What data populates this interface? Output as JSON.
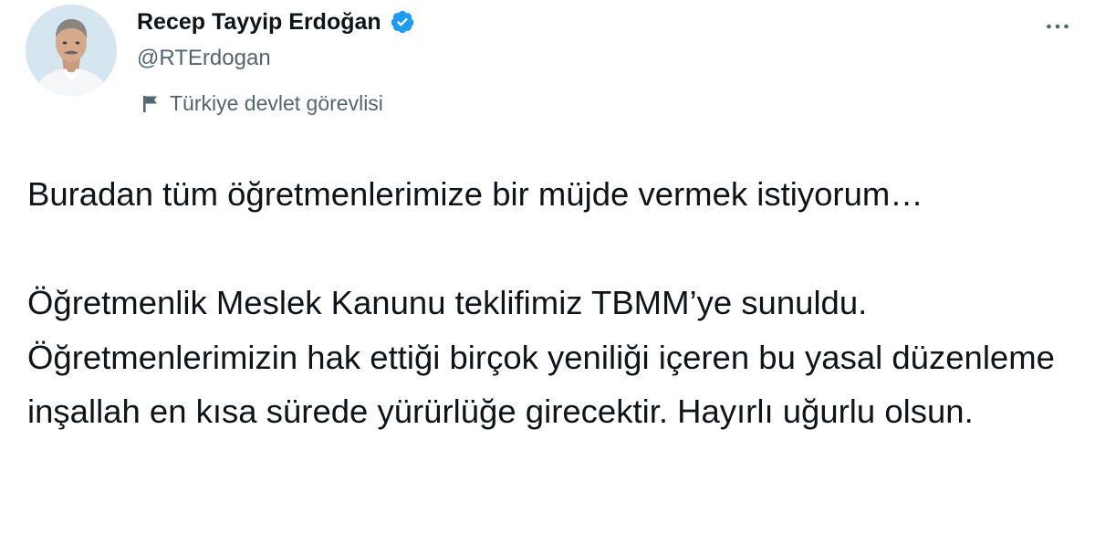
{
  "author": {
    "display_name": "Recep Tayyip Erdoğan",
    "handle": "@RTErdogan",
    "label": "Türkiye devlet görevlisi",
    "avatar_icon": "profile-photo",
    "verified_icon": "verified-badge-icon",
    "flag_icon": "flag-icon"
  },
  "menu": {
    "icon": "more-horizontal-icon"
  },
  "tweet": {
    "paragraphs": [
      "Buradan tüm öğretmenlerimize bir müjde vermek istiyorum…",
      "Öğretmenlik Meslek Kanunu teklifimiz TBMM’ye sunuldu. Öğretmenlerimizin hak ettiği birçok yeniliği içeren bu yasal düzenleme inşallah en kısa sürede yürürlüğe girecektir. Hayırlı uğurlu olsun."
    ]
  },
  "colors": {
    "text_primary": "#0f1419",
    "text_secondary": "#536471",
    "verified_blue": "#1d9bf0"
  }
}
